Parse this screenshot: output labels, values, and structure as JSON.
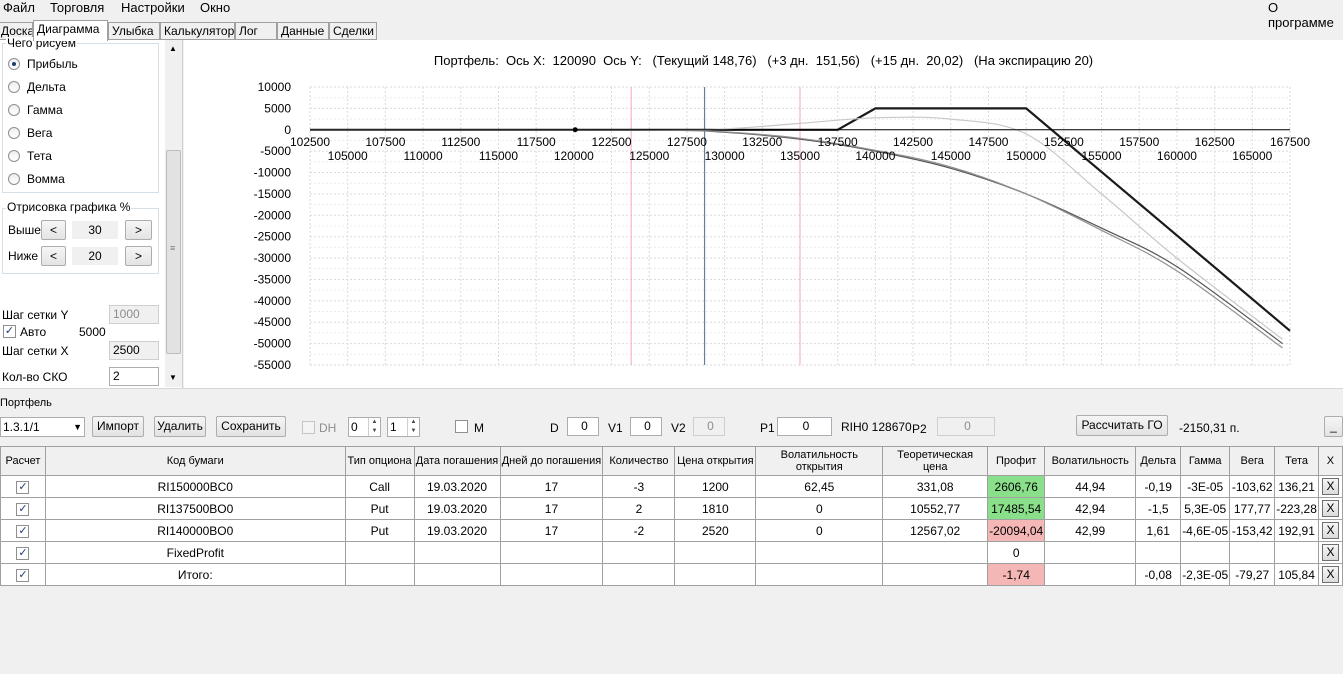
{
  "menu": {
    "file": "Файл",
    "trading": "Торговля",
    "settings": "Настройки",
    "window": "Окно",
    "about": "О программе"
  },
  "tabs": [
    "Доска",
    "Диаграмма",
    "Улыбка",
    "Калькулятор",
    "Лог",
    "Данные",
    "Сделки"
  ],
  "left": {
    "group_draw_title": "Чего рисуем",
    "radios": [
      {
        "label": "Прибыль",
        "checked": true
      },
      {
        "label": "Дельта",
        "checked": false
      },
      {
        "label": "Гамма",
        "checked": false
      },
      {
        "label": "Вега",
        "checked": false
      },
      {
        "label": "Тета",
        "checked": false
      },
      {
        "label": "Вомма",
        "checked": false
      }
    ],
    "group_render_title": "Отрисовка графика %",
    "above_label": "Выше",
    "above_value": "30",
    "below_label": "Ниже",
    "below_value": "20",
    "dec_label": "<",
    "inc_label": ">",
    "grid_y_label": "Шаг сетки Y",
    "grid_y_value": "1000",
    "auto_label": "Авто",
    "auto_value": "5000",
    "grid_x_label": "Шаг сетки X",
    "grid_x_value": "2500",
    "sko_label": "Кол-во СКО",
    "sko_value": "2"
  },
  "chart_title": "Портфель:  Ось X:  120090  Ось Y:   (Текущий 148,76)   (+3 дн.  151,56)   (+15 дн.  20,02)   (На экспирацию 20)",
  "chart_data": {
    "type": "line",
    "xlim": [
      102500,
      167500
    ],
    "ylim": [
      -55000,
      10000
    ],
    "x_ticks_upper": [
      "102500",
      "107500",
      "112500",
      "117500",
      "122500",
      "127500",
      "132500",
      "137500",
      "142500",
      "147500",
      "152500",
      "157500",
      "162500",
      "167500"
    ],
    "x_ticks_lower": [
      "105000",
      "110000",
      "115000",
      "120000",
      "125000",
      "130000",
      "135000",
      "140000",
      "145000",
      "150000",
      "155000",
      "160000",
      "165000"
    ],
    "y_ticks": [
      "10000",
      "5000",
      "0",
      "-5000",
      "-10000",
      "-15000",
      "-20000",
      "-25000",
      "-30000",
      "-35000",
      "-40000",
      "-45000",
      "-50000",
      "-55000"
    ],
    "grid": true,
    "current_price_line": 128670,
    "sigma_lines": [
      123800,
      135000
    ],
    "series": [
      {
        "role": "expiration",
        "color": "#1a1a1a",
        "x": [
          102500,
          137500,
          140000,
          150000,
          167500
        ],
        "y": [
          0,
          0,
          5000,
          5000,
          -47000
        ]
      },
      {
        "role": "current",
        "color": "#555555",
        "x": [
          102500,
          125000,
          130000,
          135000,
          140000,
          145000,
          150000,
          155000,
          160000,
          167000
        ],
        "y": [
          0,
          -100,
          -600,
          -2200,
          -5000,
          -9000,
          -15000,
          -23000,
          -32000,
          -50000
        ]
      },
      {
        "role": "plus3d",
        "color": "#909090",
        "x": [
          102500,
          125000,
          130000,
          135000,
          140000,
          145000,
          150000,
          155000,
          160000,
          167000
        ],
        "y": [
          0,
          -80,
          -500,
          -2000,
          -4800,
          -8700,
          -15000,
          -23500,
          -33000,
          -51000
        ]
      },
      {
        "role": "plus15d",
        "color": "#c8c8c8",
        "x": [
          102500,
          125000,
          130000,
          135000,
          140000,
          145000,
          150000,
          155000,
          160000,
          167000
        ],
        "y": [
          0,
          0,
          200,
          1500,
          2800,
          2500,
          -1000,
          -15000,
          -30000,
          -49000
        ]
      }
    ]
  },
  "portfolio": {
    "label": "Портфель",
    "combo_value": "1.3.1/1",
    "import": "Импорт",
    "delete": "Удалить",
    "save": "Сохранить",
    "dh": "DH",
    "spin1": "0",
    "spin2": "1",
    "m": "M",
    "d_label": "D",
    "d_value": "0",
    "v1_label": "V1",
    "v1_value": "0",
    "v2_label": "V2",
    "v2_value": "0",
    "p1_label": "P1",
    "p1_value": "0",
    "rih": "RIH0 128670",
    "p2_label": "P2",
    "p2_value": "0",
    "calc_go": "Рассчитать ГО",
    "go_value": "-2150,31 п.",
    "minimize": "_"
  },
  "grid": {
    "headers": [
      "Расчет",
      "Код бумаги",
      "Тип опциона",
      "Дата погашения",
      "Дней до погашения",
      "Количество",
      "Цена открытия",
      "Волатильность открытия",
      "Теоретическая цена",
      "Профит",
      "Волатильность",
      "Дельта",
      "Гамма",
      "Вега",
      "Тета",
      "X"
    ],
    "rows": [
      {
        "check": "✓",
        "code": "RI150000BC0",
        "type": "Call",
        "date": "19.03.2020",
        "days": "17",
        "qty": "-3",
        "open": "1200",
        "vol_open": "62,45",
        "theo": "331,08",
        "profit": "2606,76",
        "profit_class": "pos",
        "vol": "44,94",
        "delta": "-0,19",
        "gamma": "-3E-05",
        "vega": "-103,62",
        "theta": "136,21",
        "x": "X"
      },
      {
        "check": "✓",
        "code": "RI137500BO0",
        "type": "Put",
        "date": "19.03.2020",
        "days": "17",
        "qty": "2",
        "open": "1810",
        "vol_open": "0",
        "theo": "10552,77",
        "profit": "17485,54",
        "profit_class": "pos",
        "vol": "42,94",
        "delta": "-1,5",
        "gamma": "5,3E-05",
        "vega": "177,77",
        "theta": "-223,28",
        "x": "X"
      },
      {
        "check": "✓",
        "code": "RI140000BO0",
        "type": "Put",
        "date": "19.03.2020",
        "days": "17",
        "qty": "-2",
        "open": "2520",
        "vol_open": "0",
        "theo": "12567,02",
        "profit": "-20094,04",
        "profit_class": "neg",
        "vol": "42,99",
        "delta": "1,61",
        "gamma": "-4,6E-05",
        "vega": "-153,42",
        "theta": "192,91",
        "x": "X"
      },
      {
        "check": "✓",
        "code": "FixedProfit",
        "type": "",
        "date": "",
        "days": "",
        "qty": "",
        "open": "",
        "vol_open": "",
        "theo": "",
        "profit": "0",
        "profit_class": "",
        "vol": "",
        "delta": "",
        "gamma": "",
        "vega": "",
        "theta": "",
        "x": "X"
      },
      {
        "check": "✓",
        "code": "Итого:",
        "type": "",
        "date": "",
        "days": "",
        "qty": "",
        "open": "",
        "vol_open": "",
        "theo": "",
        "profit": "-1,74",
        "profit_class": "neg",
        "vol": "",
        "delta": "-0,08",
        "gamma": "-2,3E-05",
        "vega": "-79,27",
        "theta": "105,84",
        "x": "X"
      }
    ]
  }
}
